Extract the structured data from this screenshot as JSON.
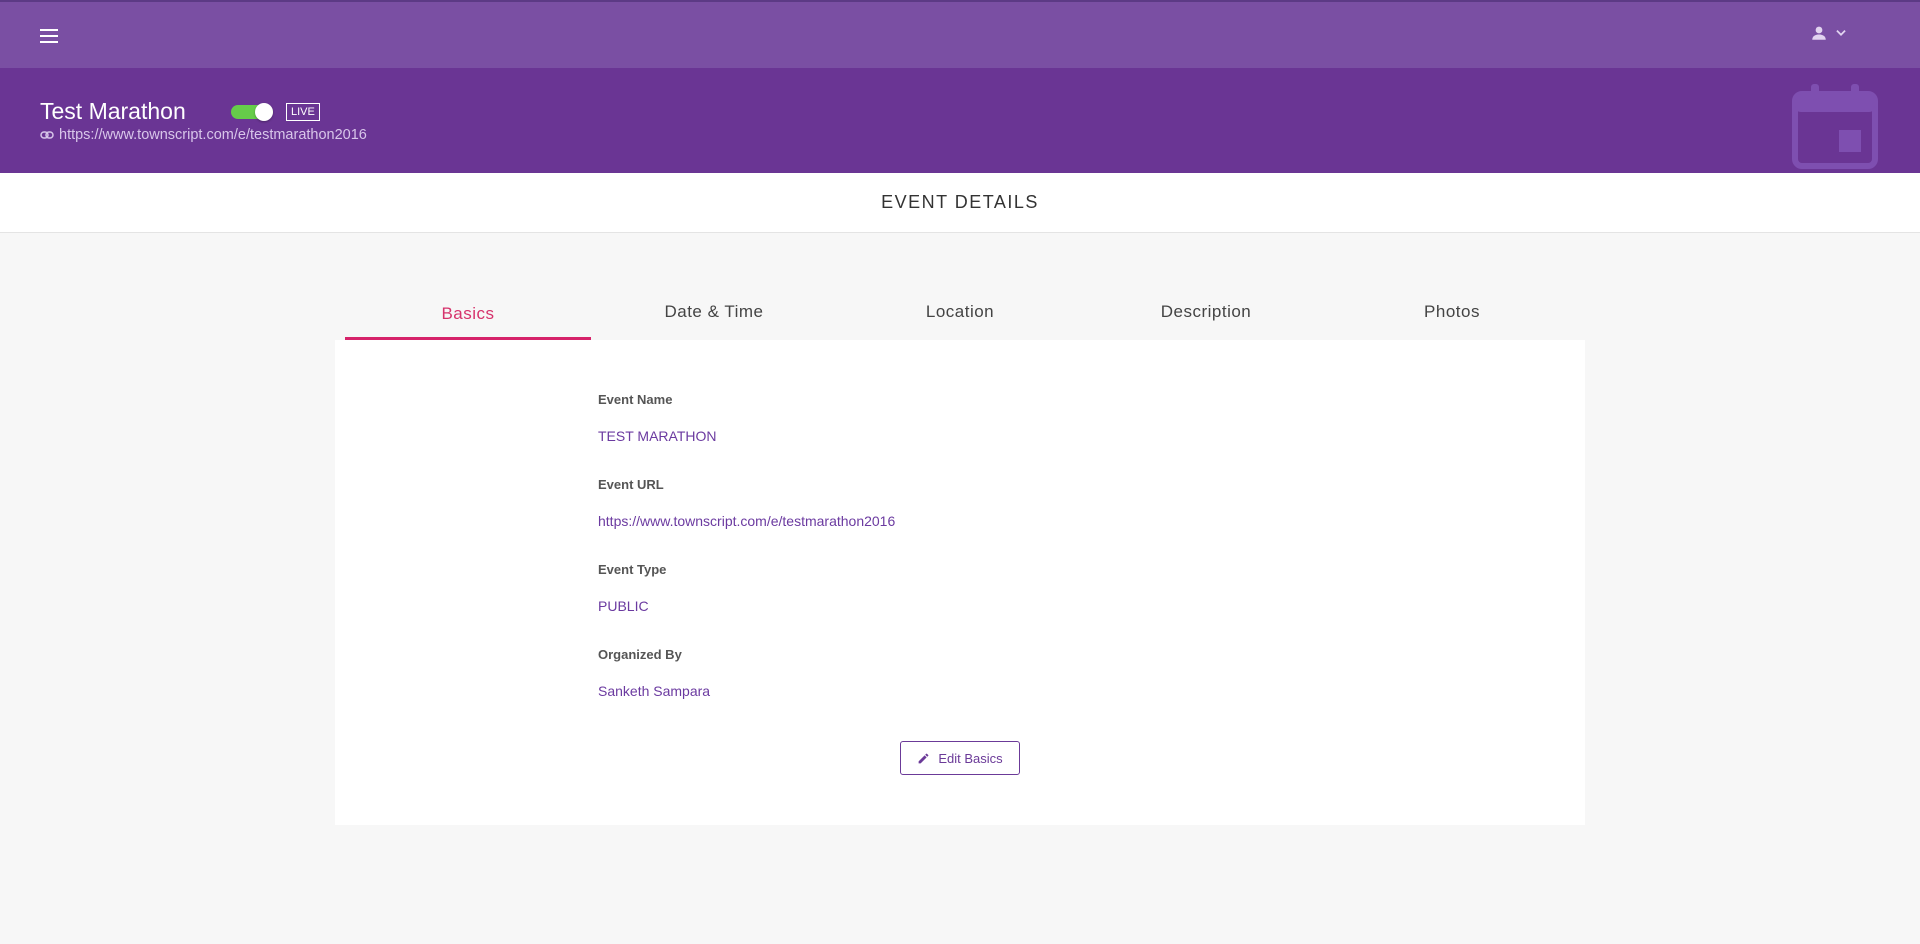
{
  "topbar": {
    "menu_icon": "hamburger-menu-icon",
    "user_icon": "user-icon",
    "dropdown_icon": "chevron-down-icon",
    "color": "#7a4fa3"
  },
  "event": {
    "title": "Test Marathon",
    "status_badge": "LIVE",
    "live_toggle_on": true,
    "url": "https://www.townscript.com/e/testmarathon2016",
    "link_icon": "link-icon",
    "header_icon": "calendar-icon",
    "header_color": "#6a3594"
  },
  "section_title": "EVENT DETAILS",
  "tabs": [
    {
      "label": "Basics",
      "active": true
    },
    {
      "label": "Date & Time",
      "active": false
    },
    {
      "label": "Location",
      "active": false
    },
    {
      "label": "Description",
      "active": false
    },
    {
      "label": "Photos",
      "active": false
    }
  ],
  "fields": [
    {
      "label": "Event Name",
      "value": "TEST MARATHON"
    },
    {
      "label": "Event URL",
      "value": "https://www.townscript.com/e/testmarathon2016"
    },
    {
      "label": "Event Type",
      "value": "PUBLIC"
    },
    {
      "label": "Organized By",
      "value": "Sanketh Sampara"
    }
  ],
  "edit_button": {
    "label": "Edit Basics",
    "icon": "pencil-icon"
  },
  "colors": {
    "accent": "#d6236a",
    "value_text": "#6b3aa0",
    "toggle_on": "#66cc4a"
  }
}
